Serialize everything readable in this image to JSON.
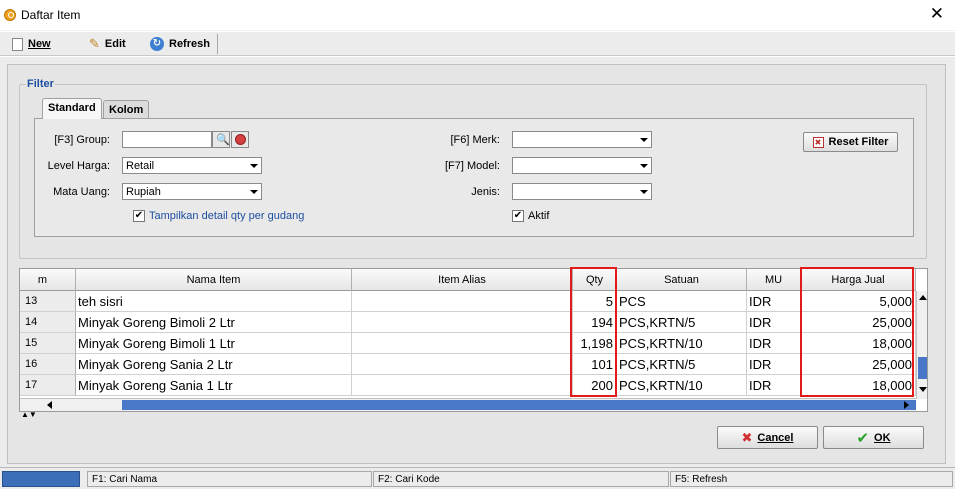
{
  "window": {
    "title": "Daftar Item"
  },
  "toolbar": {
    "new_label": "New",
    "edit_label": "Edit",
    "refresh_label": "Refresh"
  },
  "filter": {
    "legend": "Filter",
    "tabs": [
      "Standard",
      "Kolom"
    ],
    "group_label": "[F3] Group:",
    "group_value": "",
    "level_harga_label": "Level Harga:",
    "level_harga_value": "Retail",
    "mata_uang_label": "Mata Uang:",
    "mata_uang_value": "Rupiah",
    "detail_qty_label": "Tampilkan detail qty per gudang",
    "detail_qty_checked": true,
    "merk_label": "[F6] Merk:",
    "merk_value": "",
    "model_label": "[F7] Model:",
    "model_value": "",
    "jenis_label": "Jenis:",
    "jenis_value": "",
    "aktif_label": "Aktif",
    "aktif_checked": true,
    "reset_label": "Reset Filter"
  },
  "grid": {
    "columns": [
      "m",
      "Nama Item",
      "Item Alias",
      "Qty",
      "Satuan",
      "MU",
      "Harga Jual"
    ],
    "rows": [
      {
        "no": "13",
        "nama": "teh sisri",
        "alias": "",
        "qty": "5",
        "satuan": "PCS",
        "mu": "IDR",
        "harga": "5,000"
      },
      {
        "no": "14",
        "nama": "Minyak Goreng Bimoli 2 Ltr",
        "alias": "",
        "qty": "194",
        "satuan": "PCS,KRTN/5",
        "mu": "IDR",
        "harga": "25,000"
      },
      {
        "no": "15",
        "nama": "Minyak Goreng Bimoli 1 Ltr",
        "alias": "",
        "qty": "1,198",
        "satuan": "PCS,KRTN/10",
        "mu": "IDR",
        "harga": "18,000"
      },
      {
        "no": "16",
        "nama": "Minyak Goreng Sania 2 Ltr",
        "alias": "",
        "qty": "101",
        "satuan": "PCS,KRTN/5",
        "mu": "IDR",
        "harga": "25,000"
      },
      {
        "no": "17",
        "nama": "Minyak Goreng Sania 1 Ltr",
        "alias": "",
        "qty": "200",
        "satuan": "PCS,KRTN/10",
        "mu": "IDR",
        "harga": "18,000"
      }
    ]
  },
  "buttons": {
    "cancel_label": "Cancel",
    "ok_label": "OK"
  },
  "status": {
    "f1": "F1: Cari Nama",
    "f2": "F2: Cari Kode",
    "f5": "F5: Refresh"
  },
  "colors": {
    "accent": "#1f4fa0",
    "highlight": "#e21a1a"
  }
}
